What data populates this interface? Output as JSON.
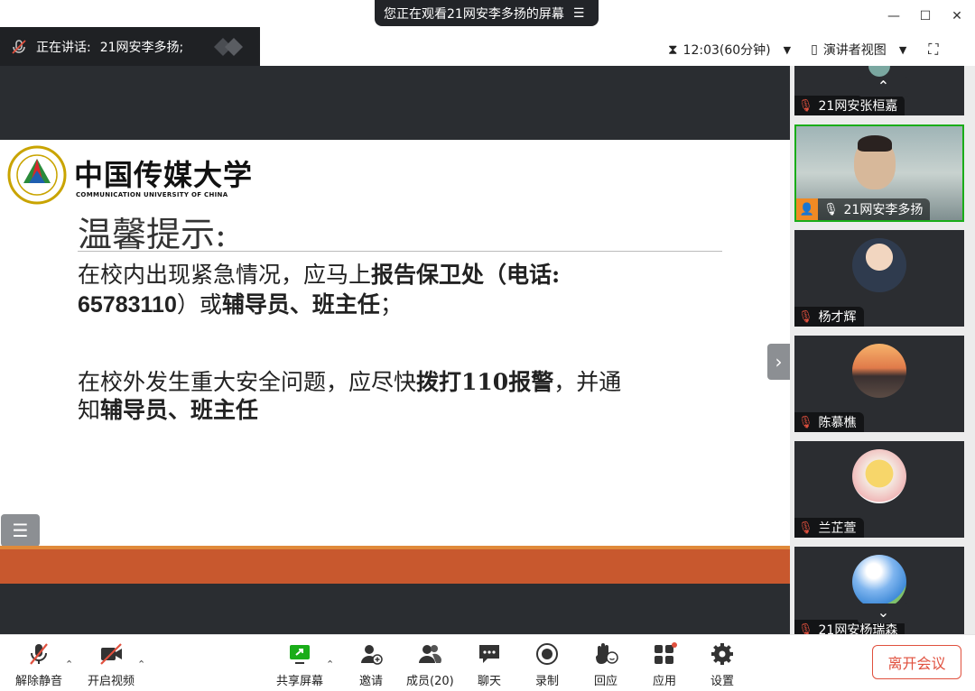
{
  "window": {
    "share_banner": "您正在观看21网安李多扬的屏幕",
    "minimize": "—",
    "maximize": "☐",
    "close": "✕"
  },
  "speaking": {
    "label": "正在讲话:",
    "name": "21网安李多扬;"
  },
  "meeting": {
    "time": "12:03(60分钟)",
    "view": "演讲者视图"
  },
  "slide": {
    "university_cn": "中国传媒大学",
    "university_en": "COMMUNICATION UNIVERSITY OF CHINA",
    "heading": "温馨提示:",
    "p1_a": " 在校内出现紧急情况，应马上",
    "p1_b": "报告保卫处（电话:",
    "p1_c": "65783110",
    "p1_d": "）或",
    "p1_e": "辅导员、班主任",
    "p1_f": "；",
    "p2_a": " 在校外发生重大安全问题，应尽快",
    "p2_b": "拨打110报警",
    "p2_c": "，并通",
    "p2_d": "知",
    "p2_e": "辅导员、班主任"
  },
  "participants": [
    {
      "name": "21网安张桓嘉",
      "muted": true
    },
    {
      "name": "21网安李多扬",
      "muted": false,
      "active": true
    },
    {
      "name": "杨才辉",
      "muted": true
    },
    {
      "name": "陈慕樵",
      "muted": true
    },
    {
      "name": "兰芷萱",
      "muted": true
    },
    {
      "name": "21网安杨瑞森",
      "muted": true
    }
  ],
  "toolbar": {
    "unmute": "解除静音",
    "video": "开启视频",
    "share": "共享屏幕",
    "invite": "邀请",
    "members": "成员(20)",
    "chat": "聊天",
    "record": "录制",
    "react": "回应",
    "apps": "应用",
    "settings": "设置",
    "leave": "离开会议"
  },
  "colors": {
    "accent_green": "#1aad19",
    "leave_red": "#e0503e",
    "slide_bar": "#c8582e"
  }
}
